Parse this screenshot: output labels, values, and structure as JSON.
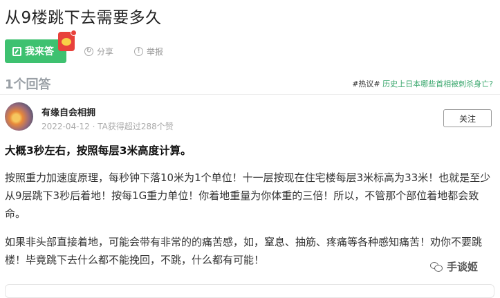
{
  "question": {
    "title": "从9楼跳下去需要多久"
  },
  "actions": {
    "answer_label": "我来答",
    "share_label": "分享",
    "report_label": "举报"
  },
  "answers_header": {
    "count_label": "1个回答",
    "hot_tag": "#热议#",
    "hot_link": "历史上日本哪些首相被刺杀身亡?"
  },
  "answer": {
    "author": "有缘自会相拥",
    "date": "2022-04-12",
    "praise": "TA获得超过288个赞",
    "follow_label": "关注",
    "lead": "大概3秒左右，按照每层3米高度计算。",
    "paragraph1": "按照重力加速度原理，每秒钟下落10米为1个单位！十一层按现在住宅楼每层3米标高为33米！也就是至少从9层跳下3秒后着地！按每1G重力单位！你着地重量为你体重的三倍！所以，不管那个部位着地都会致命。",
    "paragraph2": "如果非头部直接着地，可能会带有非常的的痛苦感，如，窒息、抽筋、疼痛等各种感知痛苦！劝你不要跳楼！毕竟跳下去什么都不能挽回，不跳，什么都有可能！"
  },
  "watermark": {
    "text": "手谈姬"
  },
  "colors": {
    "primary_green": "#3ec170",
    "link_green": "#3aa76d",
    "redpacket": "#e8413b"
  },
  "icons": [
    "edit-icon",
    "redpacket-icon",
    "share-icon",
    "report-icon",
    "avatar",
    "wechat-icon"
  ]
}
